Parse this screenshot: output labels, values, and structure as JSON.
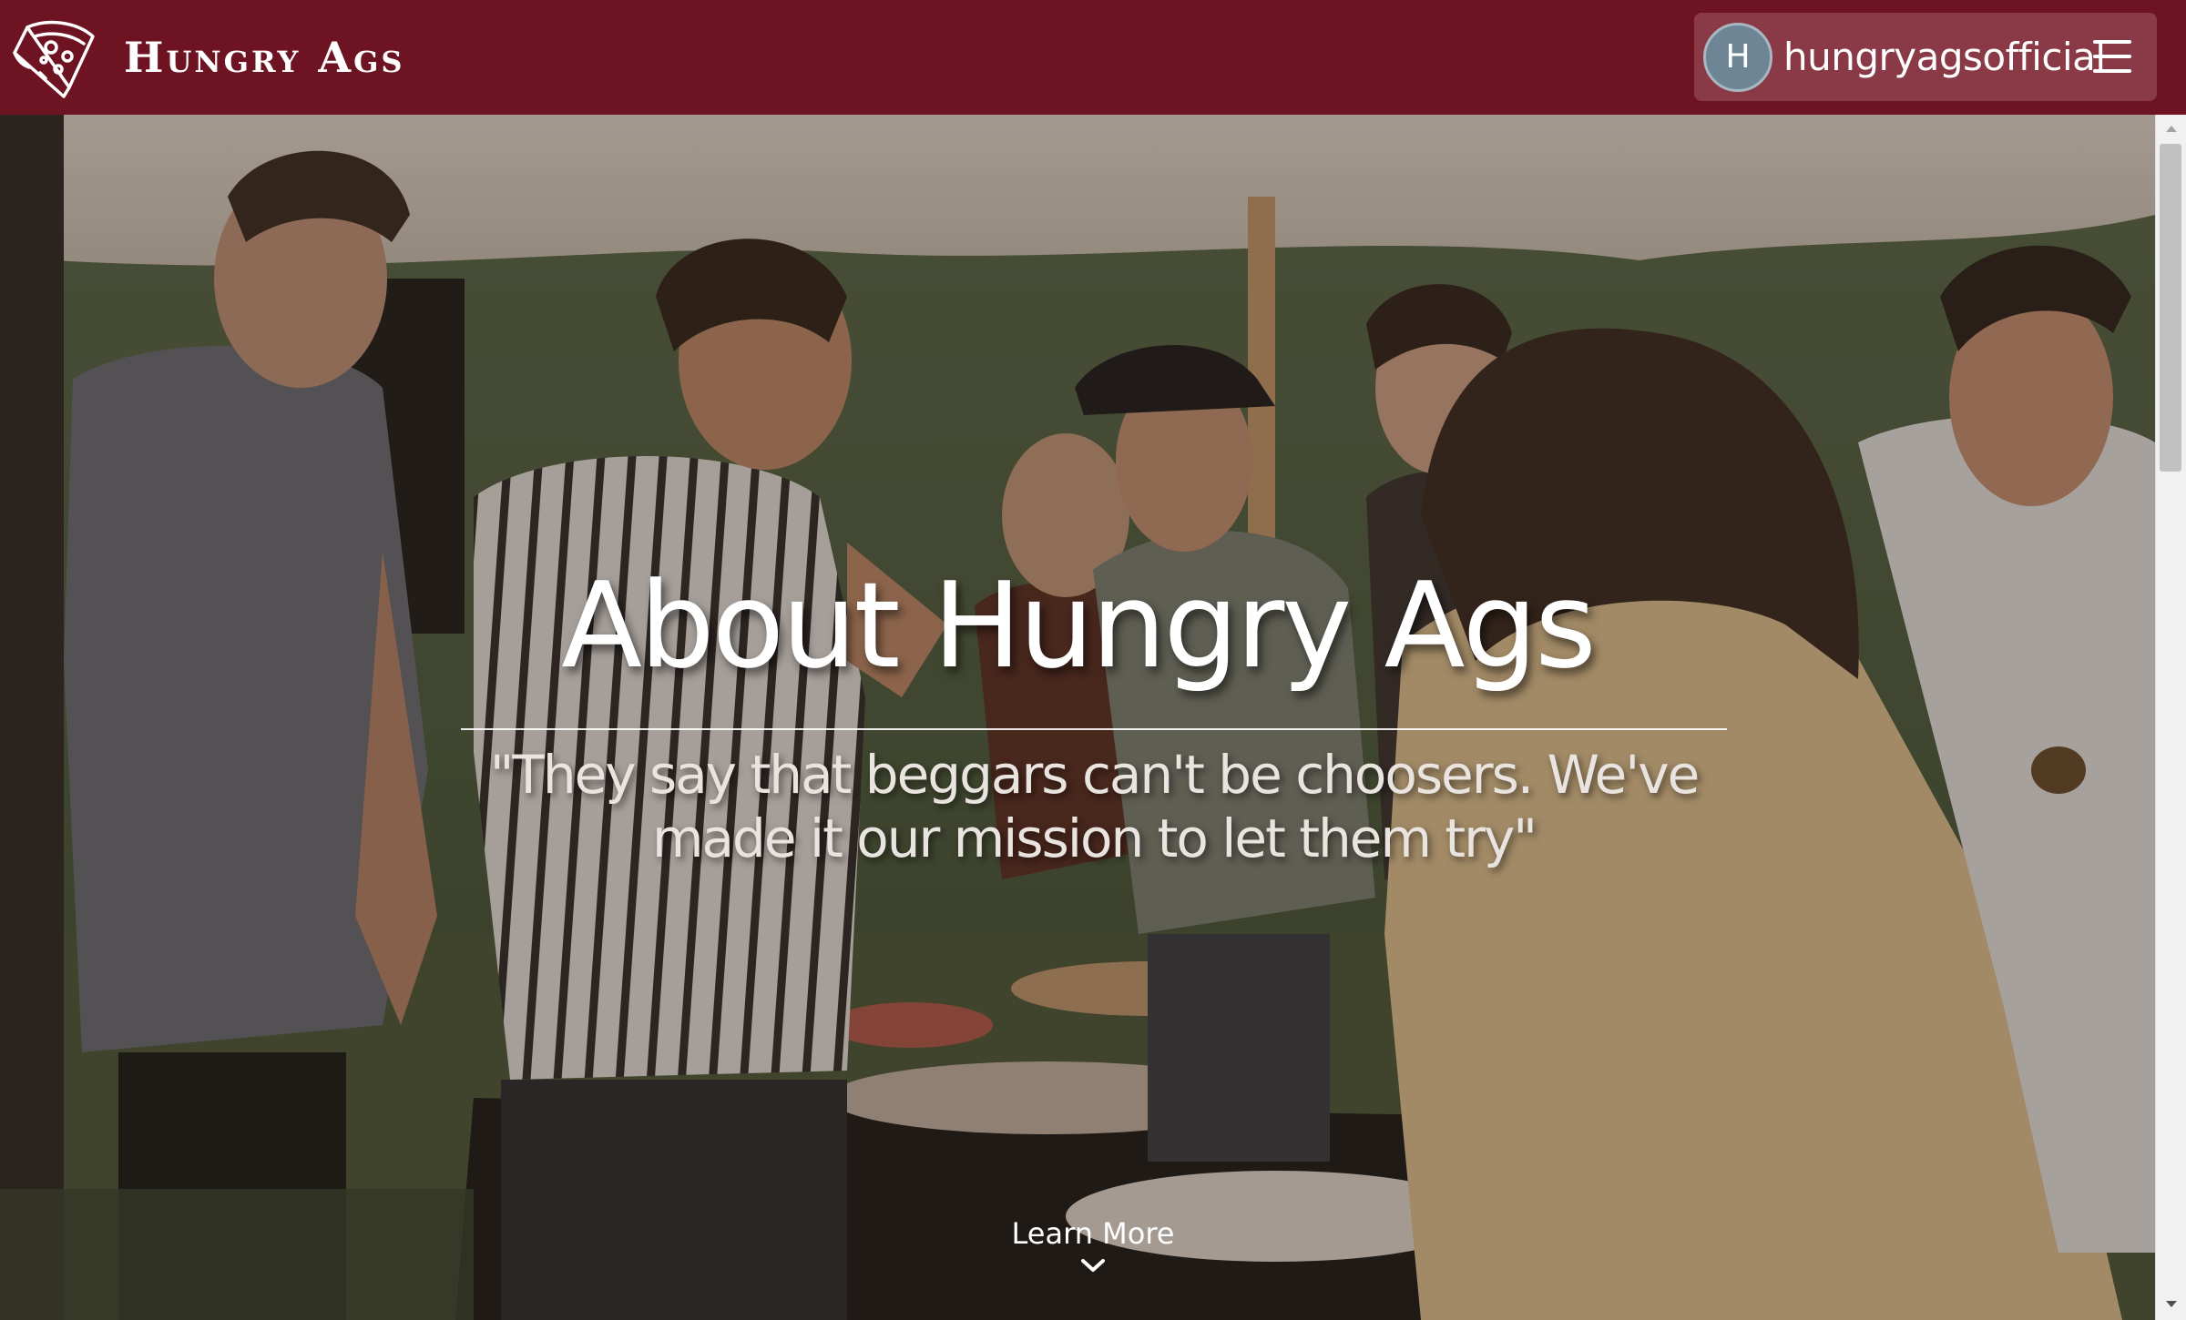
{
  "navbar": {
    "brand": "Hungry Ags",
    "brand_logo_icon": "pizza-slice-icon",
    "user": {
      "avatar_initial": "H",
      "username": "hungryagsofficial"
    },
    "menu_icon": "hamburger-menu-icon",
    "background_color": "#6e1322",
    "pill_color": "#8a3a47"
  },
  "hero": {
    "background_description_icon": "hero-photo",
    "title": "About Hungry Ags",
    "quote": "\"They say that beggars can't be choosers. We've made it our mission to let them try\"",
    "cta_label": "Learn More",
    "cta_icon": "chevron-down-icon"
  },
  "scrollbar": {
    "up_icon": "scroll-up-arrow-icon",
    "down_icon": "scroll-down-arrow-icon"
  }
}
